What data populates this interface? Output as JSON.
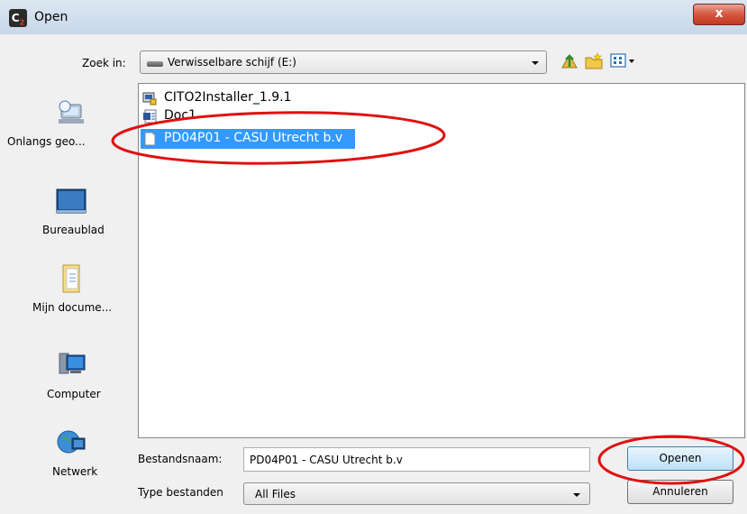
{
  "window": {
    "app_icon_text": "C",
    "title": "Open",
    "close_glyph": "x"
  },
  "lookin": {
    "label": "Zoek in:",
    "value": "Verwisselbare schijf (E:)",
    "icons": [
      "up-folder-icon",
      "new-folder-icon",
      "view-menu-icon"
    ]
  },
  "places": [
    {
      "label": "Onlangs geo...",
      "icon": "recent-places-icon"
    },
    {
      "label": "Bureaublad",
      "icon": "desktop-icon"
    },
    {
      "label": "Mijn docume...",
      "icon": "documents-icon"
    },
    {
      "label": "Computer",
      "icon": "computer-icon"
    },
    {
      "label": "Netwerk",
      "icon": "network-icon"
    }
  ],
  "files": [
    {
      "name": "CITO2Installer_1.9.1",
      "icon": "installer-icon",
      "selected": false
    },
    {
      "name": "Doc1",
      "icon": "word-document-icon",
      "selected": false
    },
    {
      "name": "PD04P01 - CASU Utrecht b.v",
      "icon": "blank-file-icon",
      "selected": true
    }
  ],
  "filename": {
    "label": "Bestandsnaam:",
    "value": "PD04P01 - CASU Utrecht b.v"
  },
  "filetype": {
    "label": "Type bestanden",
    "value": "All Files"
  },
  "buttons": {
    "open": "Openen",
    "cancel": "Annuleren"
  },
  "colors": {
    "selection": "#3399ff",
    "annotation": "#e01010"
  }
}
